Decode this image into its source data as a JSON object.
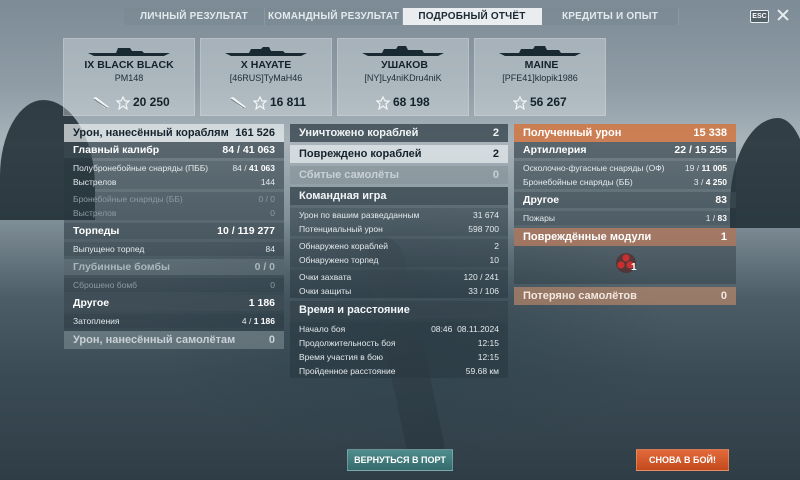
{
  "tabs": [
    {
      "label": "ЛИЧНЫЙ РЕЗУЛЬТАТ",
      "active": false
    },
    {
      "label": "КОМАНДНЫЙ РЕЗУЛЬТАТ",
      "active": false
    },
    {
      "label": "ПОДРОБНЫЙ ОТЧЁТ",
      "active": true
    },
    {
      "label": "КРЕДИТЫ И ОПЫТ",
      "active": false
    }
  ],
  "esc_label": "ESC",
  "players": [
    {
      "tier": "IX",
      "ship": "BLACK BLACK",
      "player": "PM148",
      "xp": "20 250",
      "has_kill_icon": true
    },
    {
      "tier": "X",
      "ship": "HAYATE",
      "player": "[46RUS]TyMaH46",
      "xp": "16 811",
      "has_kill_icon": true
    },
    {
      "tier": "",
      "ship": "УШАКОВ",
      "player": "[NY]Ly4niKDru4niK",
      "xp": "68 198",
      "has_kill_icon": false
    },
    {
      "tier": "",
      "ship": "MAINE",
      "player": "[PFE41]klopik1986",
      "xp": "56 267",
      "has_kill_icon": false
    }
  ],
  "left": {
    "damage": {
      "label": "Урон, нанесённый кораблям",
      "value": "161 526"
    },
    "main_battery": {
      "label": "Главный калибр",
      "num": "84",
      "den": "41 063"
    },
    "he": {
      "label": "Полубронебойные снаряды (ПББ)",
      "num": "84",
      "den": "41 063"
    },
    "shots": {
      "label": "Выстрелов",
      "value": "144"
    },
    "ap": {
      "label": "Бронебойные снаряды (ББ)",
      "value": "0 / 0"
    },
    "ap_shots": {
      "label": "Выстрелов",
      "value": "0"
    },
    "torpedoes": {
      "label": "Торпеды",
      "num": "10",
      "den": "119 277"
    },
    "torp_launched": {
      "label": "Выпущено торпед",
      "value": "84"
    },
    "depth": {
      "label": "Глубинные бомбы",
      "value": "0 / 0"
    },
    "depth_dropped": {
      "label": "Сброшено бомб",
      "value": "0"
    },
    "other": {
      "label": "Другое",
      "value": "1 186"
    },
    "flooding": {
      "label": "Затопления",
      "num": "4",
      "den": "1 186"
    },
    "aircraft_damage": {
      "label": "Урон, нанесённый самолётам",
      "value": "0"
    }
  },
  "mid": {
    "destroyed": {
      "label": "Уничтожено кораблей",
      "value": "2"
    },
    "damaged": {
      "label": "Повреждено кораблей",
      "value": "2"
    },
    "planes": {
      "label": "Сбитые самолёты",
      "value": "0"
    },
    "team": {
      "label": "Командная игра"
    },
    "spotting_damage": {
      "label": "Урон по вашим разведданным",
      "value": "31 674"
    },
    "potential": {
      "label": "Потенциальный урон",
      "value": "598 700"
    },
    "ships_spotted": {
      "label": "Обнаружено кораблей",
      "value": "2"
    },
    "torps_spotted": {
      "label": "Обнаружено торпед",
      "value": "10"
    },
    "capture": {
      "label": "Очки захвата",
      "value": "120 / 241"
    },
    "defense": {
      "label": "Очки защиты",
      "value": "33 / 106"
    },
    "time": {
      "label": "Время и расстояние"
    },
    "start": {
      "label": "Начало боя",
      "time": "08:46",
      "date": "08.11.2024"
    },
    "duration": {
      "label": "Продолжительность боя",
      "value": "12:15"
    },
    "participation": {
      "label": "Время участия в бою",
      "value": "12:15"
    },
    "distance": {
      "label": "Пройденное расстояние",
      "value": "59.68 км"
    }
  },
  "right": {
    "received": {
      "label": "Полученный урон",
      "value": "15 338"
    },
    "artillery": {
      "label": "Артиллерия",
      "num": "22",
      "den": "15 255"
    },
    "he": {
      "label": "Осколочно-фугасные снаряды (ОФ)",
      "num": "19",
      "den": "11 005"
    },
    "ap": {
      "label": "Бронебойные снаряды (ББ)",
      "num": "3",
      "den": "4 250"
    },
    "other": {
      "label": "Другое",
      "value": "83"
    },
    "fires": {
      "label": "Пожары",
      "num": "1",
      "den": "83"
    },
    "modules": {
      "label": "Повреждённые модули",
      "value": "1"
    },
    "module_count": "1",
    "planes_lost": {
      "label": "Потеряно самолётов",
      "value": "0"
    }
  },
  "buttons": {
    "port": "ВЕРНУТЬСЯ В ПОРТ",
    "battle": "СНОВА В БОЙ!"
  },
  "colors": {
    "accent_orange": "#d2784a",
    "teal_button": "#4f8d8e",
    "battle_button": "#e36a3a"
  }
}
